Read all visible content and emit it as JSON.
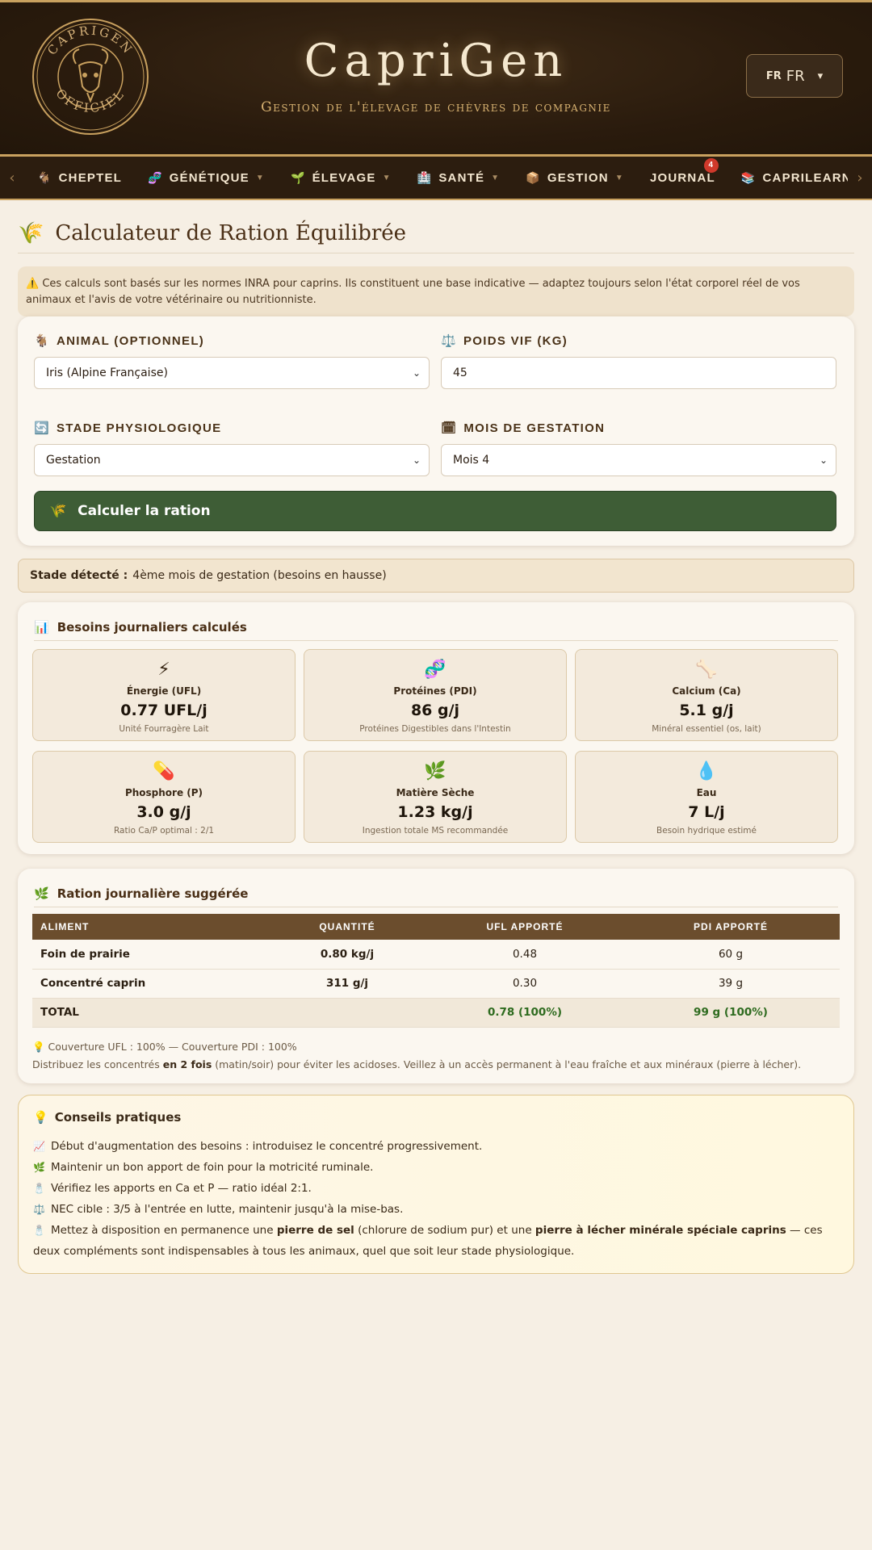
{
  "header": {
    "seal_top": "CAPRIGEN",
    "seal_bottom": "OFFICIEL",
    "brand": "CapriGen",
    "tagline": "Gestion de l'élevage de chèvres de compagnie",
    "lang_flag": "FR",
    "lang_value": "FR"
  },
  "nav": {
    "items": [
      {
        "icon": "🐐",
        "label": "CHEPTEL",
        "dropdown": ""
      },
      {
        "icon": "🧬",
        "label": "GÉNÉTIQUE",
        "dropdown": "▼"
      },
      {
        "icon": "🌱",
        "label": "ÉLEVAGE",
        "dropdown": "▼"
      },
      {
        "icon": "🏥",
        "label": "SANTÉ",
        "dropdown": "▼"
      },
      {
        "icon": "📦",
        "label": "GESTION",
        "dropdown": "▼"
      },
      {
        "icon": "",
        "label": "JOURNAL",
        "dropdown": "",
        "badge": "4"
      },
      {
        "icon": "📚",
        "label": "CAPRILEARN",
        "dropdown": ""
      },
      {
        "icon": "📖",
        "label": "",
        "dropdown": ""
      }
    ]
  },
  "page": {
    "title_icon": "🌾",
    "title": "Calculateur de Ration Équilibrée",
    "warning": "⚠️ Ces calculs sont basés sur les normes INRA pour caprins. Ils constituent une base indicative — adaptez toujours selon l'état corporel réel de vos animaux et l'avis de votre vétérinaire ou nutritionniste."
  },
  "form": {
    "animal_label": "ANIMAL (OPTIONNEL)",
    "animal_value": "Iris (Alpine Française)",
    "weight_label": "POIDS VIF (KG)",
    "weight_value": "45",
    "stage_label": "STADE PHYSIOLOGIQUE",
    "stage_value": "Gestation",
    "month_label": "MOIS DE GESTATION",
    "month_value": "Mois 4",
    "button": "Calculer la ration"
  },
  "stage_detected": {
    "label": "Stade détecté :",
    "value": "4ème mois de gestation (besoins en hausse)"
  },
  "needs": {
    "title": "Besoins journaliers calculés",
    "tiles": [
      {
        "icon": "⚡",
        "name": "Énergie (UFL)",
        "value": "0.77 UFL/j",
        "sub": "Unité Fourragère Lait"
      },
      {
        "icon": "🧬",
        "name": "Protéines (PDI)",
        "value": "86 g/j",
        "sub": "Protéines Digestibles dans l'Intestin"
      },
      {
        "icon": "🦴",
        "name": "Calcium (Ca)",
        "value": "5.1 g/j",
        "sub": "Minéral essentiel (os, lait)"
      },
      {
        "icon": "💊",
        "name": "Phosphore (P)",
        "value": "3.0 g/j",
        "sub": "Ratio Ca/P optimal : 2/1"
      },
      {
        "icon": "🌿",
        "name": "Matière Sèche",
        "value": "1.23 kg/j",
        "sub": "Ingestion totale MS recommandée"
      },
      {
        "icon": "💧",
        "name": "Eau",
        "value": "7 L/j",
        "sub": "Besoin hydrique estimé"
      }
    ]
  },
  "ration": {
    "title": "Ration journalière suggérée",
    "headers": [
      "ALIMENT",
      "QUANTITÉ",
      "UFL APPORTÉ",
      "PDI APPORTÉ"
    ],
    "rows": [
      [
        "Foin de prairie",
        "0.80 kg/j",
        "0.48",
        "60 g"
      ],
      [
        "Concentré caprin",
        "311 g/j",
        "0.30",
        "39 g"
      ]
    ],
    "total": [
      "TOTAL",
      "",
      "0.78 (100%)",
      "99 g (100%)"
    ],
    "coverage": "💡 Couverture UFL : 100% — Couverture PDI : 100%",
    "advice_pre": "Distribuez les concentrés ",
    "advice_bold": "en 2 fois",
    "advice_post": " (matin/soir) pour éviter les acidoses. Veillez à un accès permanent à l'eau fraîche et aux minéraux (pierre à lécher)."
  },
  "tips": {
    "title": "Conseils pratiques",
    "items": [
      {
        "icon": "📈",
        "text": "Début d'augmentation des besoins : introduisez le concentré progressivement."
      },
      {
        "icon": "🌿",
        "text": "Maintenir un bon apport de foin pour la motricité ruminale."
      },
      {
        "icon": "🧂",
        "text": "Vérifiez les apports en Ca et P — ratio idéal 2:1."
      },
      {
        "icon": "⚖️",
        "text": "NEC cible : 3/5 à l'entrée en lutte, maintenir jusqu'à la mise-bas."
      }
    ],
    "last_icon": "🧂",
    "last_pre": "Mettez à disposition en permanence une ",
    "last_b1": "pierre de sel",
    "last_mid": " (chlorure de sodium pur) et une ",
    "last_b2": "pierre à lécher minérale spéciale caprins",
    "last_post": " — ces deux compléments sont indispensables à tous les animaux, quel que soit leur stade physiologique."
  }
}
